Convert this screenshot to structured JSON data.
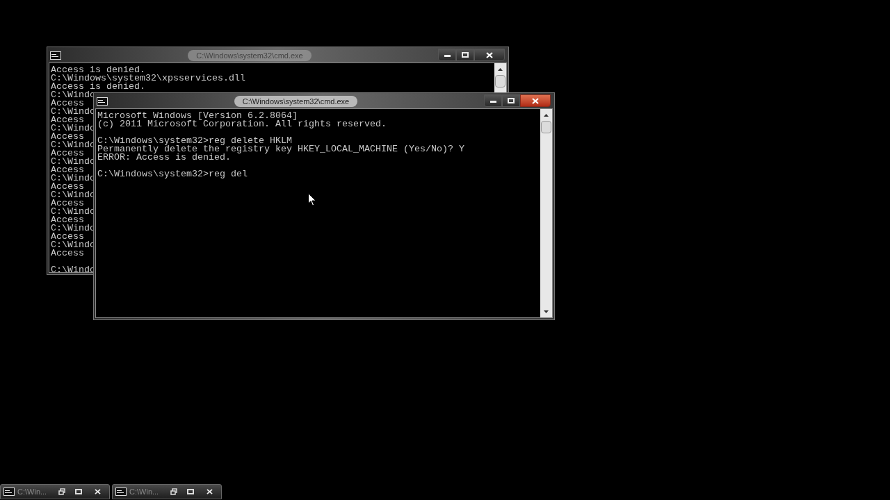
{
  "windows": [
    {
      "title": "C:\\Windows\\system32\\cmd.exe",
      "active": false,
      "blocks": [
        [
          "Access is denied.",
          "C:\\Windows\\system32\\xpsservices.dll",
          "Access is denied.",
          "C:\\Windo",
          "Access",
          "C:\\Windo",
          "Access",
          "C:\\Windo",
          "Access",
          "C:\\Windo",
          "Access",
          "C:\\Windo",
          "Access",
          "C:\\Windo",
          "Access",
          "C:\\Windo",
          "Access",
          "C:\\Windo",
          "Access",
          "C:\\Windo",
          "Access",
          "C:\\Windo",
          "Access"
        ],
        [
          "C:\\Windo"
        ]
      ]
    },
    {
      "title": "C:\\Windows\\system32\\cmd.exe",
      "active": true,
      "blocks": [
        [
          "Microsoft Windows [Version 6.2.8064]",
          "(c) 2011 Microsoft Corporation. All rights reserved."
        ],
        [
          "C:\\Windows\\system32>reg delete HKLM",
          "Permanently delete the registry key HKEY_LOCAL_MACHINE (Yes/No)? Y",
          "ERROR: Access is denied."
        ],
        [
          "C:\\Windows\\system32>reg del"
        ]
      ]
    }
  ],
  "taskbar": [
    {
      "title": "C:\\Win..."
    },
    {
      "title": "C:\\Win..."
    }
  ]
}
